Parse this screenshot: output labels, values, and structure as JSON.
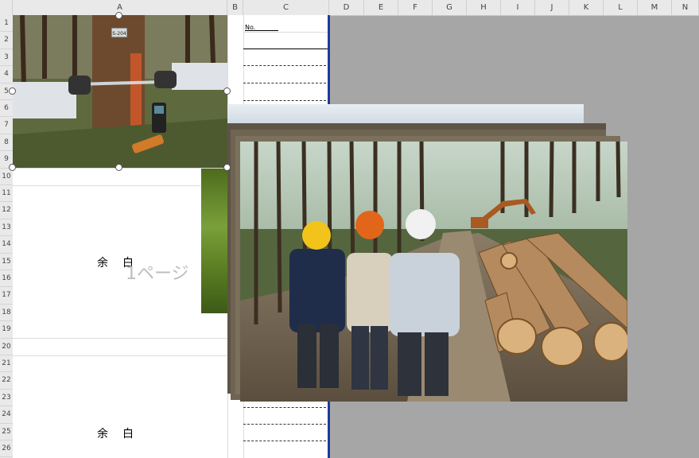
{
  "column_headers": [
    "A",
    "B",
    "C",
    "D",
    "E",
    "F",
    "G",
    "H",
    "I",
    "J",
    "K",
    "L",
    "M",
    "N"
  ],
  "row_headers": [
    "1",
    "2",
    "3",
    "4",
    "5",
    "6",
    "7",
    "8",
    "9",
    "10",
    "11",
    "12",
    "13",
    "14",
    "15",
    "16",
    "17",
    "18",
    "19",
    "20",
    "21",
    "22",
    "23",
    "24",
    "25",
    "26"
  ],
  "cells": {
    "blank_upper": "余白",
    "blank_lower": "余白",
    "page_watermark": "1ページ",
    "c1_text": "No."
  },
  "images": {
    "tree_measure": "tree-diameter-measurement-photo",
    "tree_tag": "S-204",
    "forest_workers": "forest-workers-log-yard-photo"
  },
  "colors": {
    "header_bg": "#e9e9e9",
    "outside_area": "#a6a6a6",
    "print_border": "#1f3a9b"
  }
}
